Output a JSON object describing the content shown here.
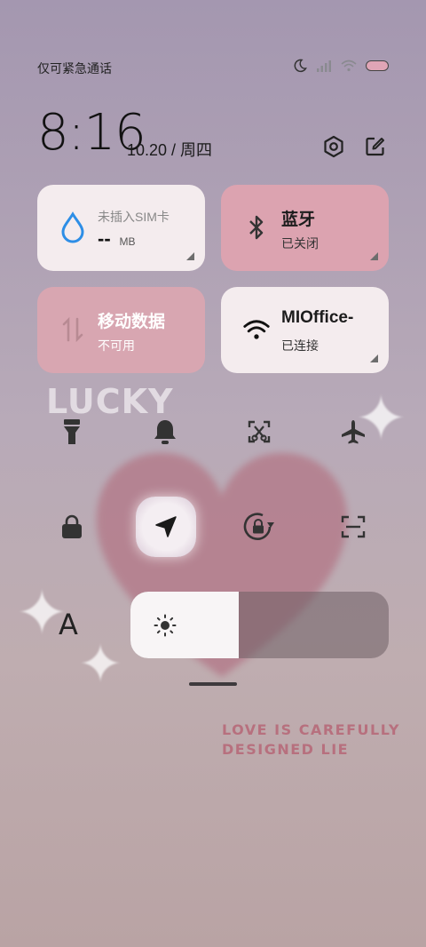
{
  "status_bar": {
    "carrier_text": "仅可紧急通话",
    "icons": [
      "moon-icon",
      "signal-icon",
      "wifi-icon",
      "battery-icon"
    ]
  },
  "header": {
    "time": "8:16",
    "date": "10.20 / 周四",
    "settings_icon": "gear-icon",
    "edit_icon": "edit-icon"
  },
  "tiles": [
    {
      "title": "未插入SIM卡",
      "value": "--",
      "unit": "MB",
      "icon": "water-drop-icon"
    },
    {
      "title": "蓝牙",
      "subtitle": "已关闭",
      "icon": "bluetooth-icon"
    },
    {
      "title": "移动数据",
      "subtitle": "不可用",
      "icon": "data-arrows-icon"
    },
    {
      "title": "MIOffice-",
      "subtitle": "已连接",
      "icon": "wifi-icon"
    }
  ],
  "toggles_row1": [
    "flashlight-icon",
    "bell-icon",
    "screenshot-icon",
    "airplane-icon"
  ],
  "toggles_row2": [
    "lock-icon",
    "location-icon",
    "rotation-lock-icon",
    "scan-icon"
  ],
  "brightness": {
    "level": 0.42,
    "font_button": "A"
  },
  "wallpaper": {
    "text1": "LUCKY",
    "text2_line1": "LOVE IS CAREFULLY",
    "text2_line2": "DESIGNED LIE"
  },
  "colors": {
    "tile_light": "#f4ecee",
    "tile_pink": "#dca3b0",
    "accent_blue": "#2d8ee6"
  }
}
